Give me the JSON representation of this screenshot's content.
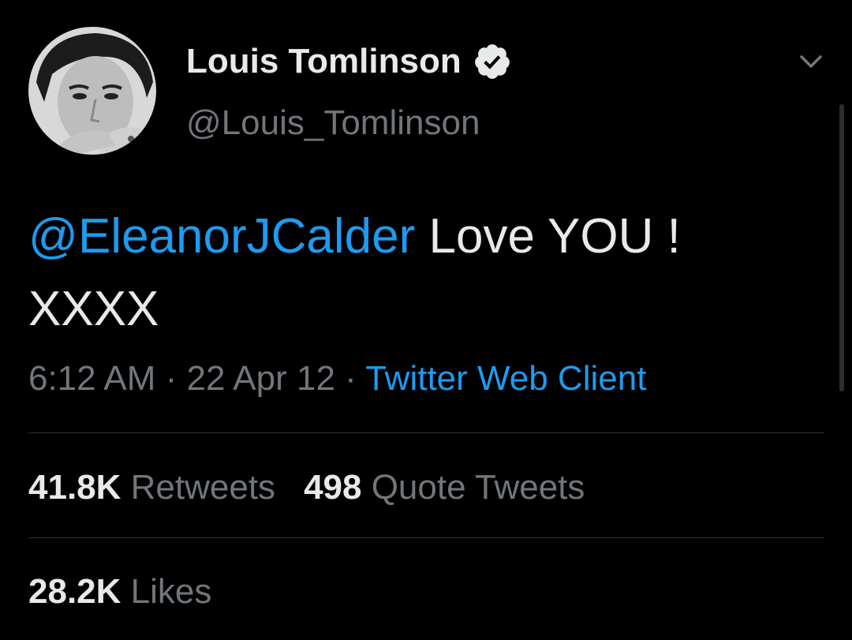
{
  "author": {
    "display_name": "Louis Tomlinson",
    "handle": "@Louis_Tomlinson",
    "verified": true
  },
  "tweet": {
    "mention": "@EleanorJCalder",
    "text": " Love YOU !",
    "line2": "XXXX"
  },
  "meta": {
    "time": "6:12 AM",
    "sep1": " · ",
    "date": "22 Apr 12",
    "sep2": " · ",
    "client": "Twitter Web Client"
  },
  "stats": {
    "retweets_count": "41.8K",
    "retweets_label": " Retweets",
    "quotes_count": "498",
    "quotes_label": " Quote Tweets",
    "likes_count": "28.2K",
    "likes_label": " Likes"
  },
  "colors": {
    "background": "#000000",
    "accent": "#1d9bf0",
    "primary_text": "#e7e9ea",
    "secondary_text": "#71767b",
    "divider": "#2f3336"
  },
  "icons": {
    "verified": "verified-badge-icon",
    "more": "chevron-down-icon",
    "avatar": "profile-photo"
  }
}
